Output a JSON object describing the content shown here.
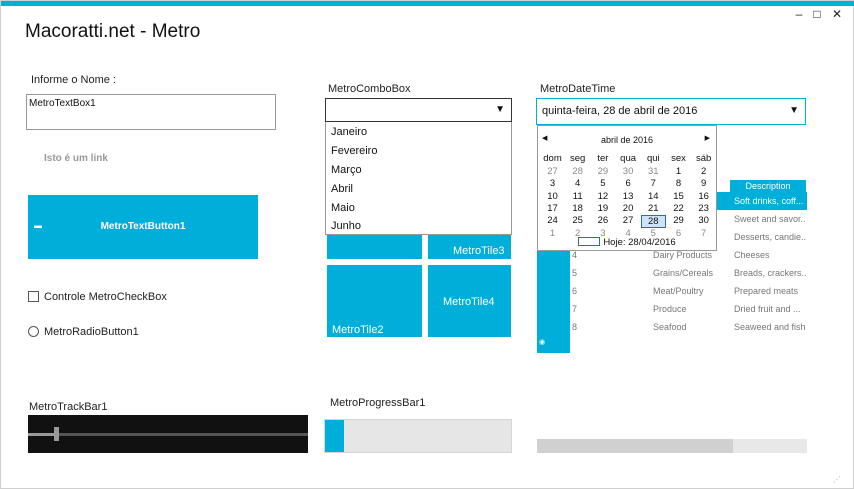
{
  "window": {
    "title": "Macoratti.net - Metro",
    "minimize": "–",
    "maximize": "□",
    "close": "✕",
    "accent": "#00aeda"
  },
  "name_label": "Informe o Nome :",
  "textbox_value": "MetroTextBox1",
  "link_label": "Isto é um link",
  "text_button_label": "MetroTextButton1",
  "checkbox_label": "Controle MetroCheckBox",
  "radio_label": "MetroRadioButton1",
  "trackbar": {
    "label": "MetroTrackBar1",
    "value": 10
  },
  "combo": {
    "label": "MetroComboBox",
    "selected": "",
    "options": [
      "Janeiro",
      "Fevereiro",
      "Março",
      "Abril",
      "Maio",
      "Junho"
    ]
  },
  "tiles": {
    "tile2": "MetroTile2",
    "tile3": "MetroTile3",
    "tile4": "MetroTile4"
  },
  "progress": {
    "label": "MetroProgressBar1",
    "value": 10
  },
  "datetime": {
    "label": "MetroDateTime",
    "value": "quinta-feira, 28 de abril de 2016",
    "calendar": {
      "month_title": "abril de 2016",
      "dow": [
        "dom",
        "seg",
        "ter",
        "qua",
        "qui",
        "sex",
        "sáb"
      ],
      "weeks": [
        [
          "27",
          "28",
          "29",
          "30",
          "31",
          "1",
          "2"
        ],
        [
          "3",
          "4",
          "5",
          "6",
          "7",
          "8",
          "9"
        ],
        [
          "10",
          "11",
          "12",
          "13",
          "14",
          "15",
          "16"
        ],
        [
          "17",
          "18",
          "19",
          "20",
          "21",
          "22",
          "23"
        ],
        [
          "24",
          "25",
          "26",
          "27",
          "28",
          "29",
          "30"
        ],
        [
          "1",
          "2",
          "3",
          "4",
          "5",
          "6",
          "7"
        ]
      ],
      "selected_day": "28",
      "today_label": "Hoje: 28/04/2016"
    }
  },
  "grid": {
    "header_description": "Description",
    "rows": [
      {
        "id": "",
        "name": "",
        "desc": "Soft drinks, coff...",
        "selected": true
      },
      {
        "id": "",
        "name": "",
        "desc": "Sweet and savor..."
      },
      {
        "id": "",
        "name": "",
        "desc": "Desserts, candie..."
      },
      {
        "id": "4",
        "name": "Dairy Products",
        "desc": "Cheeses"
      },
      {
        "id": "5",
        "name": "Grains/Cereals",
        "desc": "Breads, crackers..."
      },
      {
        "id": "6",
        "name": "Meat/Poultry",
        "desc": "Prepared meats"
      },
      {
        "id": "7",
        "name": "Produce",
        "desc": "Dried fruit and ..."
      },
      {
        "id": "8",
        "name": "Seafood",
        "desc": "Seaweed and fish"
      }
    ]
  }
}
